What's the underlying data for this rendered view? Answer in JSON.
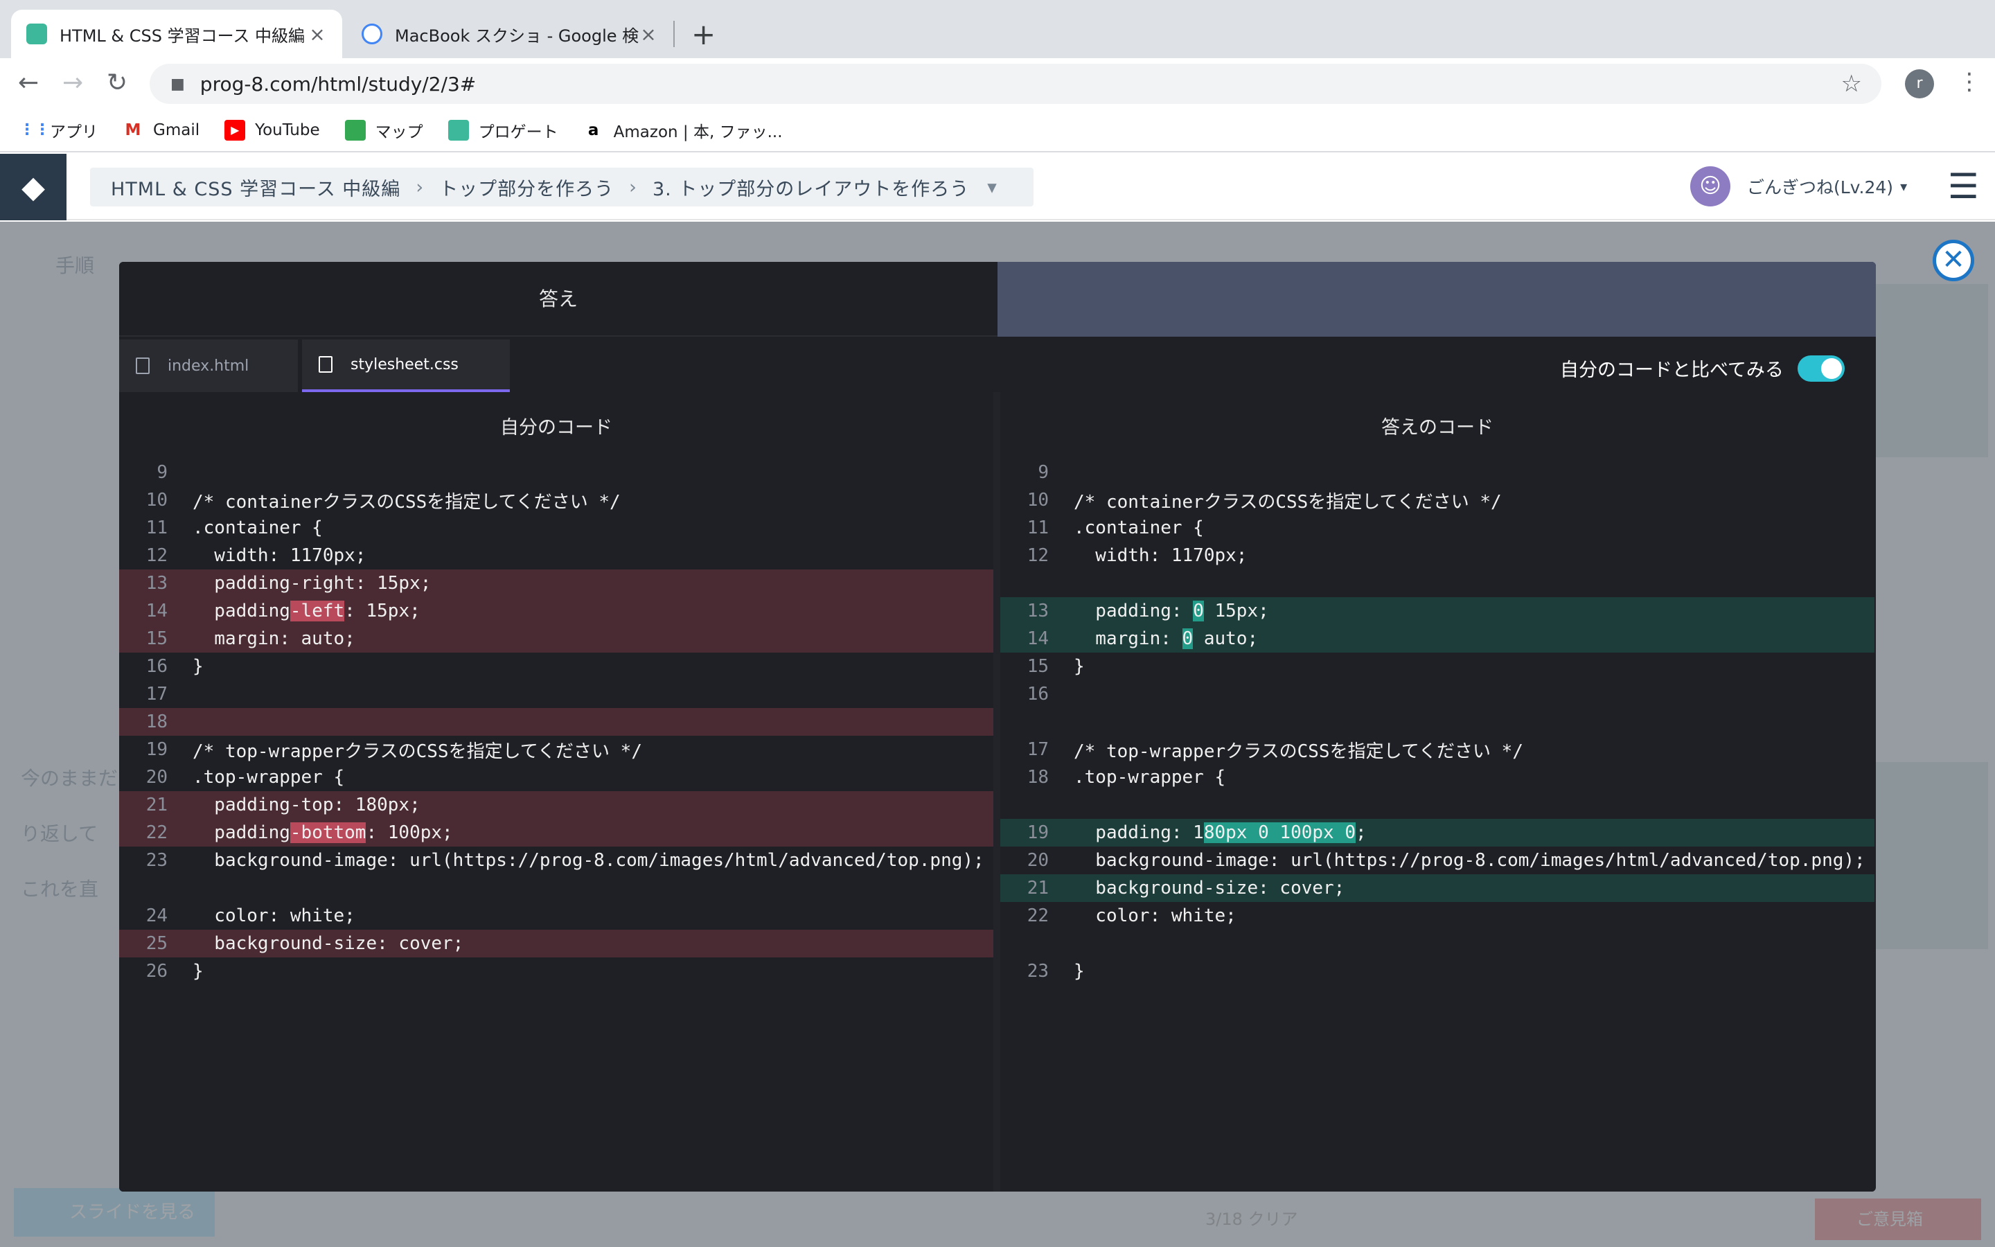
{
  "browser": {
    "tabs": [
      {
        "title": "HTML & CSS 学習コース 中級編 |",
        "active": true
      },
      {
        "title": "MacBook スクショ - Google 検索",
        "active": false
      }
    ],
    "url": "prog-8.com/html/study/2/3#",
    "profile_initial": "r",
    "bookmarks": [
      "アプリ",
      "Gmail",
      "YouTube",
      "マップ",
      "プロゲート",
      "Amazon | 本, ファッ..."
    ]
  },
  "header": {
    "breadcrumb": [
      "HTML & CSS 学習コース 中級編",
      "トップ部分を作ろう",
      "3. トップ部分のレイアウトを作ろう"
    ],
    "user_name": "ごんぎつね(Lv.24)"
  },
  "modal": {
    "title": "答え",
    "file_tabs": [
      "index.html",
      "stylesheet.css"
    ],
    "active_file": "stylesheet.css",
    "compare_label": "自分のコードと比べてみる",
    "compare_enabled": true,
    "left_title": "自分のコード",
    "right_title": "答えのコード"
  },
  "colors": {
    "accent": "#2bc1d3",
    "deleted": "#4a2b33",
    "added": "#1c3d3a",
    "tab_underline": "#7b68ee"
  },
  "background_page": {
    "left_items": [
      "手順",
      "今のままだと",
      "り返して",
      "これを直"
    ],
    "bottom_left_button": "スライドを見る",
    "progress": "3/18 クリア",
    "bottom_right_button": "ご意見箱"
  },
  "left_code": [
    {
      "n": "9",
      "t": "",
      "mark": ""
    },
    {
      "n": "10",
      "t": "/* containerクラスのCSSを指定してください */",
      "mark": ""
    },
    {
      "n": "11",
      "t": ".container {",
      "mark": ""
    },
    {
      "n": "12",
      "t": "  width: 1170px;",
      "mark": ""
    },
    {
      "n": "13",
      "t": "  padding-right: 15px;",
      "mark": "del"
    },
    {
      "n": "14",
      "segs": [
        "  padding",
        "-left",
        ": 15px;"
      ],
      "mark": "del"
    },
    {
      "n": "15",
      "t": "  margin: auto;",
      "mark": "del"
    },
    {
      "n": "16",
      "t": "}",
      "mark": ""
    },
    {
      "n": "17",
      "t": "",
      "mark": ""
    },
    {
      "n": "18",
      "t": "",
      "mark": "del"
    },
    {
      "n": "19",
      "t": "/* top-wrapperクラスのCSSを指定してください */",
      "mark": ""
    },
    {
      "n": "20",
      "t": ".top-wrapper {",
      "mark": ""
    },
    {
      "n": "21",
      "t": "  padding-top: 180px;",
      "mark": "del"
    },
    {
      "n": "22",
      "segs": [
        "  padding",
        "-bottom",
        ": 100px;"
      ],
      "mark": "del"
    },
    {
      "n": "23",
      "t": "  background-image: url(https://prog-8.com/images/html/advanced/top.png);",
      "mark": ""
    },
    {
      "n": "",
      "t": "",
      "mark": ""
    },
    {
      "n": "24",
      "t": "  color: white;",
      "mark": ""
    },
    {
      "n": "25",
      "t": "  background-size: cover;",
      "mark": "del"
    },
    {
      "n": "26",
      "t": "}",
      "mark": ""
    }
  ],
  "right_code": [
    {
      "n": "9",
      "t": "",
      "mark": ""
    },
    {
      "n": "10",
      "t": "/* containerクラスのCSSを指定してください */",
      "mark": ""
    },
    {
      "n": "11",
      "t": ".container {",
      "mark": ""
    },
    {
      "n": "12",
      "t": "  width: 1170px;",
      "mark": ""
    },
    {
      "n": "",
      "t": "",
      "mark": ""
    },
    {
      "n": "13",
      "segs": [
        "  padding: ",
        "0",
        " 15px;"
      ],
      "mark": "add"
    },
    {
      "n": "14",
      "segs": [
        "  margin: ",
        "0",
        " auto;"
      ],
      "mark": "add"
    },
    {
      "n": "15",
      "t": "}",
      "mark": ""
    },
    {
      "n": "16",
      "t": "",
      "mark": ""
    },
    {
      "n": "",
      "t": "",
      "mark": ""
    },
    {
      "n": "17",
      "t": "/* top-wrapperクラスのCSSを指定してください */",
      "mark": ""
    },
    {
      "n": "18",
      "t": ".top-wrapper {",
      "mark": ""
    },
    {
      "n": "",
      "t": "",
      "mark": ""
    },
    {
      "n": "19",
      "segs5": [
        "  padding: 1",
        "80px 0 100px 0",
        ";"
      ],
      "mark": "add"
    },
    {
      "n": "20",
      "t": "  background-image: url(https://prog-8.com/images/html/advanced/top.png);",
      "mark": ""
    },
    {
      "n": "21",
      "t": "  background-size: cover;",
      "mark": "add"
    },
    {
      "n": "22",
      "t": "  color: white;",
      "mark": ""
    },
    {
      "n": "",
      "t": "",
      "mark": ""
    },
    {
      "n": "23",
      "t": "}",
      "mark": ""
    }
  ]
}
